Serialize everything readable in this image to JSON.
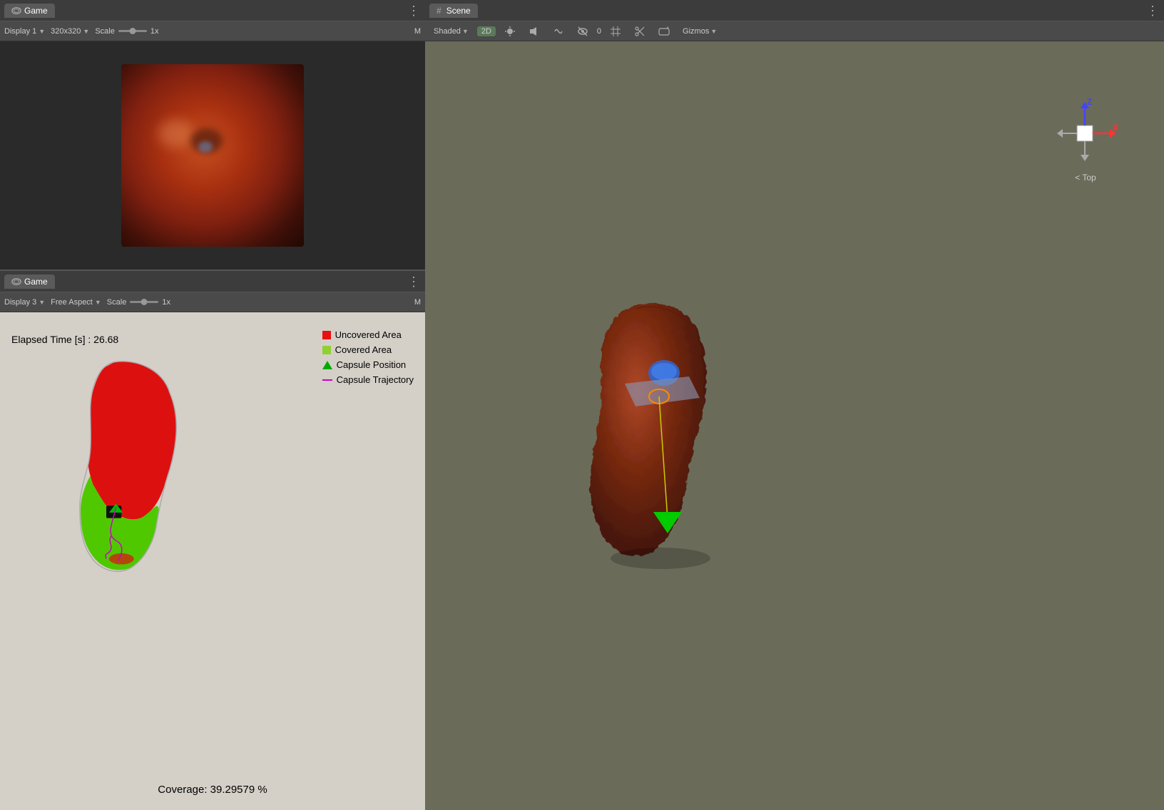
{
  "game_panel_top": {
    "tab_label": "Game",
    "dots": "⋮",
    "display_label": "Display 1",
    "resolution": "320x320",
    "scale_label": "Scale",
    "scale_value": "1x",
    "m_label": "M"
  },
  "game_panel_bottom": {
    "tab_label": "Game",
    "dots": "⋮",
    "display_label": "Display 3",
    "aspect_label": "Free Aspect",
    "scale_label": "Scale",
    "scale_value": "1x",
    "m_label": "M",
    "elapsed_time": "Elapsed Time [s] : 26.68",
    "coverage": "Coverage: 39.29579 %",
    "legend": {
      "uncovered_label": "Uncovered Area",
      "covered_label": "Covered Area",
      "position_label": "Capsule Position",
      "trajectory_label": "Capsule Trajectory"
    }
  },
  "scene_panel": {
    "tab_label": "Scene",
    "dots": "⋮",
    "shading_label": "Shaded",
    "btn_2d": "2D",
    "gizmos_label": "Gizmos",
    "top_label": "< Top",
    "axis_z": "Z",
    "axis_x": "X"
  },
  "colors": {
    "uncovered_red": "#e81010",
    "covered_green": "#50c000",
    "capsule_position": "#006600",
    "trajectory_magenta": "#cc00cc",
    "organ_3d_brown": "#8b3a1a"
  }
}
